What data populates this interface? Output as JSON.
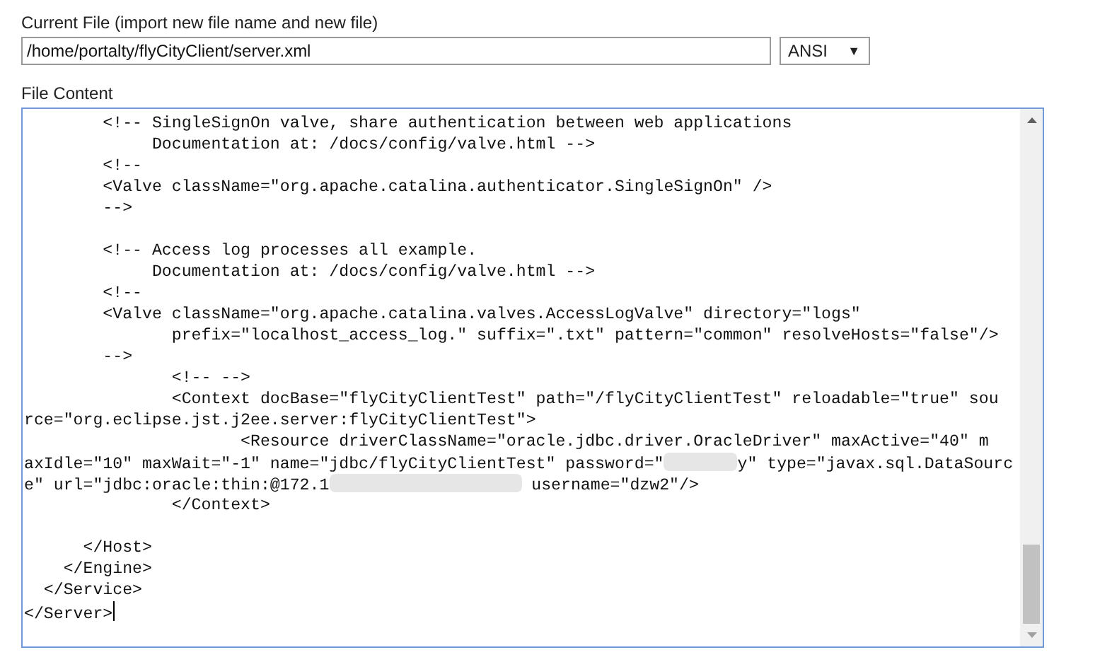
{
  "current_file": {
    "label": "Current File (import new file name and new file)",
    "value": "/home/portalty/flyCityClient/server.xml",
    "encoding": "ANSI",
    "dropdown_arrow": "▼"
  },
  "file_content": {
    "label": "File Content",
    "lines": [
      "        <!-- SingleSignOn valve, share authentication between web applications",
      "             Documentation at: /docs/config/valve.html -->",
      "        <!--",
      "        <Valve className=\"org.apache.catalina.authenticator.SingleSignOn\" />",
      "        -->",
      {
        "kind": "blank"
      },
      "        <!-- Access log processes all example.",
      "             Documentation at: /docs/config/valve.html -->",
      "        <!--",
      "        <Valve className=\"org.apache.catalina.valves.AccessLogValve\" directory=\"logs\"",
      "               prefix=\"localhost_access_log.\" suffix=\".txt\" pattern=\"common\" resolveHosts=\"false\"/>",
      "        -->",
      "               <!-- -->",
      "               <Context docBase=\"flyCityClientTest\" path=\"/flyCityClientTest\" reloadable=\"true\" sou",
      "rce=\"org.eclipse.jst.j2ee.server:flyCityClientTest\">",
      "                      <Resource driverClassName=\"oracle.jdbc.driver.OracleDriver\" maxActive=\"40\" m",
      [
        {
          "kind": "text",
          "text": "axIdle=\"10\" maxWait=\"-1\" name=\"jdbc/flyCityClientTest\" password=\""
        },
        {
          "kind": "redacted-short"
        },
        {
          "kind": "text",
          "text": "y\" type=\"javax.sql.DataSourc"
        }
      ],
      [
        {
          "kind": "text",
          "text": "e\" url=\"jdbc:oracle:thin:@172.1"
        },
        {
          "kind": "redacted-long"
        },
        {
          "kind": "text",
          "text": " username=\"dzw2\"/>"
        }
      ],
      "               </Context>",
      {
        "kind": "blank"
      },
      "      </Host>",
      "    </Engine>",
      "  </Service>",
      "</Server>"
    ]
  }
}
